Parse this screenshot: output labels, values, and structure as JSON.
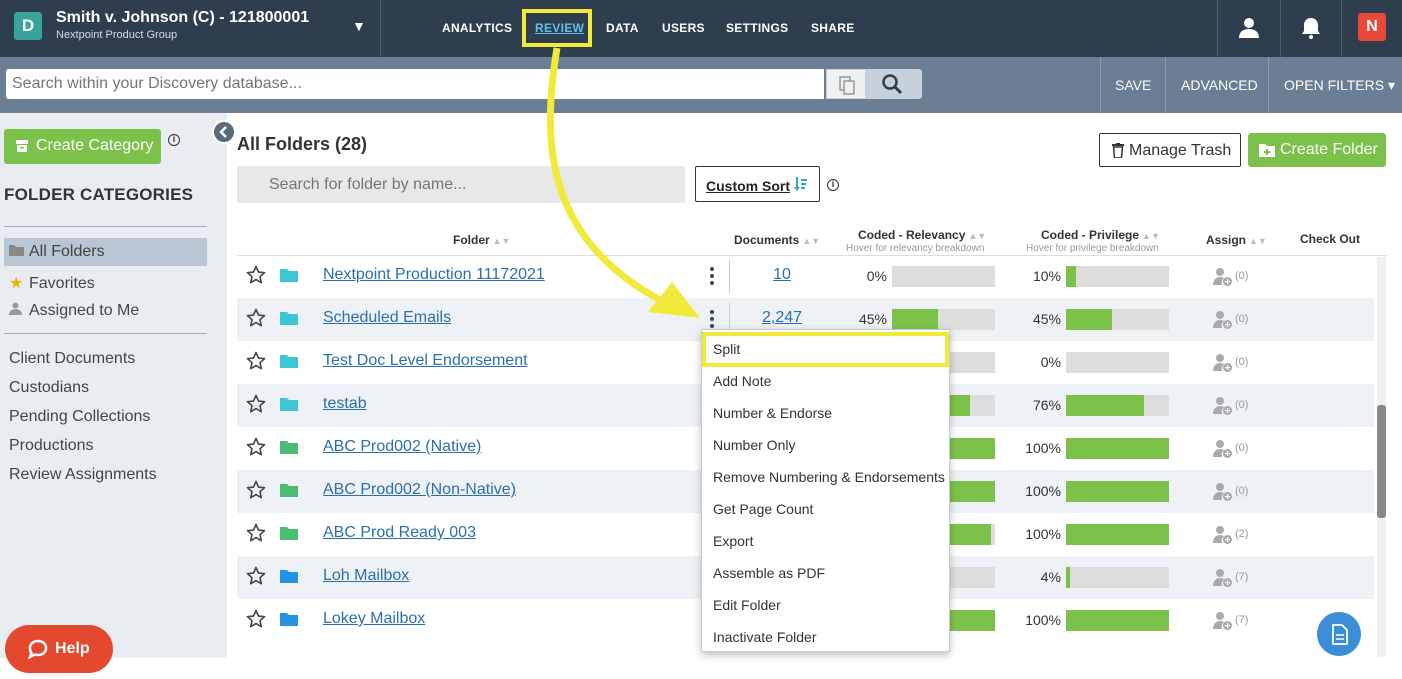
{
  "header": {
    "app_badge": "D",
    "case_title": "Smith v. Johnson (C) - 121800001",
    "case_org": "Nextpoint Product Group",
    "nav": [
      {
        "label": "ANALYTICS",
        "active": false
      },
      {
        "label": "REVIEW",
        "active": true
      },
      {
        "label": "DATA",
        "active": false
      },
      {
        "label": "USERS",
        "active": false
      },
      {
        "label": "SETTINGS",
        "active": false
      },
      {
        "label": "SHARE",
        "active": false
      }
    ],
    "icons": [
      "user-icon",
      "bell-icon",
      "nextpoint-logo"
    ],
    "brand_letter": "N"
  },
  "search": {
    "placeholder": "Search within your Discovery database...",
    "save_label": "SAVE",
    "advanced_label": "ADVANCED",
    "open_filters_label": "OPEN FILTERS ▾"
  },
  "sidebar": {
    "create_category_label": "Create Category",
    "info_symbol": "i",
    "heading": "FOLDER CATEGORIES",
    "primary_items": [
      {
        "label": "All Folders",
        "icon": "folder-icon",
        "selected": true
      },
      {
        "label": "Favorites",
        "icon": "star-icon",
        "selected": false
      },
      {
        "label": "Assigned to Me",
        "icon": "person-icon",
        "selected": false
      }
    ],
    "category_items": [
      "Client Documents",
      "Custodians",
      "Pending Collections",
      "Productions",
      "Review Assignments"
    ],
    "help_label": "Help"
  },
  "main": {
    "title": "All Folders (28)",
    "folder_search_placeholder": "Search for folder by name...",
    "custom_sort_label": "Custom Sort",
    "manage_trash_label": "Manage Trash",
    "create_folder_label": "Create Folder",
    "columns": {
      "folder": "Folder",
      "documents": "Documents",
      "relevancy": "Coded - Relevancy",
      "relevancy_hint": "Hover for relevancy breakdown",
      "privilege": "Coded - Privilege",
      "privilege_hint": "Hover for privilege breakdown",
      "assign": "Assign",
      "checkout": "Check Out"
    },
    "rows": [
      {
        "name": "Nextpoint Production 11172021",
        "folder_color": "#3fc6d4",
        "documents": "10",
        "relevancy": 0,
        "relevancy_label": "0%",
        "privilege": 10,
        "privilege_label": "10%",
        "assign": "(0)"
      },
      {
        "name": "Scheduled Emails",
        "folder_color": "#3fc6d4",
        "documents": "2,247",
        "relevancy": 45,
        "relevancy_label": "45%",
        "privilege": 45,
        "privilege_label": "45%",
        "assign": "(0)"
      },
      {
        "name": "Test Doc Level Endorsement",
        "folder_color": "#3fc6d4",
        "documents": "",
        "relevancy": 0,
        "relevancy_label": "",
        "privilege": 0,
        "privilege_label": "0%",
        "assign": "(0)"
      },
      {
        "name": "testab",
        "folder_color": "#3fc6d4",
        "documents": "",
        "relevancy": 76,
        "relevancy_label": "",
        "privilege": 76,
        "privilege_label": "76%",
        "assign": "(0)"
      },
      {
        "name": "ABC Prod002 (Native)",
        "folder_color": "#4cbc74",
        "documents": "",
        "relevancy": 100,
        "relevancy_label": "",
        "privilege": 100,
        "privilege_label": "100%",
        "assign": "(0)"
      },
      {
        "name": "ABC Prod002 (Non-Native)",
        "folder_color": "#4cbc74",
        "documents": "",
        "relevancy": 100,
        "relevancy_label": "",
        "privilege": 100,
        "privilege_label": "100%",
        "assign": "(0)"
      },
      {
        "name": "ABC Prod Ready 003",
        "folder_color": "#4cbc74",
        "documents": "",
        "relevancy": 96,
        "relevancy_label": "",
        "privilege": 100,
        "privilege_label": "100%",
        "assign": "(2)"
      },
      {
        "name": "Loh Mailbox",
        "folder_color": "#2592e6",
        "documents": "",
        "relevancy": 0,
        "relevancy_label": "",
        "privilege": 4,
        "privilege_label": "4%",
        "assign": "(7)"
      },
      {
        "name": "Lokey Mailbox",
        "folder_color": "#2592e6",
        "documents": "",
        "relevancy": 100,
        "relevancy_label": "",
        "privilege": 100,
        "privilege_label": "100%",
        "assign": "(7)"
      }
    ]
  },
  "context_menu": {
    "items": [
      "Split",
      "Add Note",
      "Number & Endorse",
      "Number Only",
      "Remove Numbering & Endorsements",
      "Get Page Count",
      "Export",
      "Assemble as PDF",
      "Edit Folder",
      "Inactivate Folder"
    ],
    "highlighted": "Split"
  },
  "colors": {
    "topbar": "#2f3e4e",
    "searchbar": "#6b7e94",
    "accent_green": "#7cc24a",
    "link_blue": "#2a6fb0",
    "annotation_yellow": "#f2ea3a",
    "help_red": "#e3492f"
  }
}
